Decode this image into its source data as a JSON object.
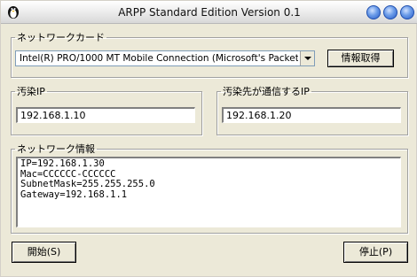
{
  "window": {
    "title": "ARPP Standard Edition Version 0.1",
    "accent_color": "#2a5cc9",
    "app_icon": "penguin-icon"
  },
  "network_card": {
    "legend": "ネットワークカード",
    "selected": "Intel(R) PRO/1000 MT Mobile Connection (Microsoft's Packet",
    "get_info_label": "情報取得"
  },
  "source_ip": {
    "legend": "汚染IP",
    "value": "192.168.1.10"
  },
  "dest_ip": {
    "legend": "汚染先が通信するIP",
    "value": "192.168.1.20"
  },
  "network_info": {
    "legend": "ネットワーク情報",
    "lines": [
      "IP=192.168.1.30",
      "Mac=CCCCCC-CCCCCC",
      "SubnetMask=255.255.255.0",
      "Gateway=192.168.1.1"
    ]
  },
  "buttons": {
    "start_label": "開始(S)",
    "stop_label": "停止(P)"
  }
}
